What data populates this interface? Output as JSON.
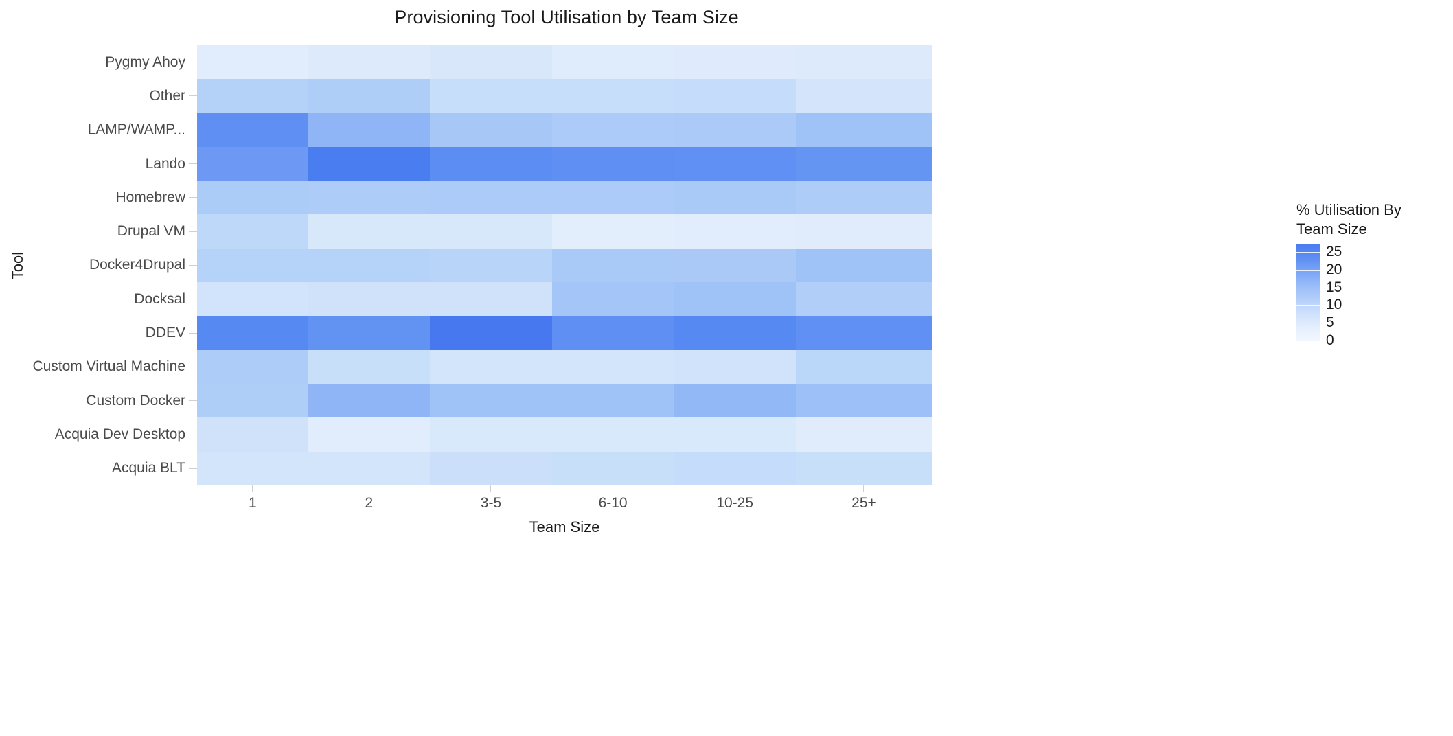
{
  "chart_data": {
    "type": "heatmap",
    "title": "Provisioning Tool Utilisation by Team Size",
    "xlabel": "Team Size",
    "ylabel": "Tool",
    "legend_title": "% Utilisation By\nTeam Size",
    "legend_position": "right",
    "grid": false,
    "x_categories": [
      "1",
      "2",
      "3-5",
      "6-10",
      "10-25",
      "25+"
    ],
    "y_categories": [
      "Pygmy Ahoy",
      "Other",
      "LAMP/WAMP...",
      "Lando",
      "Homebrew",
      "Drupal VM",
      "Docker4Drupal",
      "Docksal",
      "DDEV",
      "Custom Virtual Machine",
      "Custom Docker",
      "Acquia Dev Desktop",
      "Acquia BLT"
    ],
    "zlim": [
      0,
      27
    ],
    "legend_ticks": [
      "25",
      "20",
      "15",
      "10",
      "5",
      "0"
    ],
    "legend_tick_values": [
      25,
      20,
      15,
      10,
      5,
      0
    ],
    "colorscale_low": "#f2f7ff",
    "colorscale_high": "#3f6fe8",
    "values": [
      [
        3.0,
        3.2,
        4.0,
        3.4,
        3.0,
        3.2
      ],
      [
        9.0,
        10.5,
        6.5,
        6.5,
        6.8,
        4.5
      ],
      [
        23.0,
        14.5,
        11.0,
        10.0,
        10.5,
        12.5
      ],
      [
        20.5,
        26.5,
        22.0,
        21.5,
        21.0,
        20.0
      ],
      [
        9.5,
        9.5,
        9.5,
        9.5,
        10.0,
        9.5
      ],
      [
        7.5,
        4.5,
        4.5,
        3.0,
        3.5,
        3.5
      ],
      [
        8.5,
        8.5,
        8.0,
        10.0,
        10.0,
        11.5
      ],
      [
        5.0,
        5.5,
        5.5,
        11.0,
        11.5,
        9.0
      ],
      [
        21.5,
        19.5,
        25.0,
        20.0,
        21.5,
        20.0
      ],
      [
        9.5,
        6.5,
        5.0,
        5.0,
        5.5,
        8.0
      ],
      [
        9.5,
        14.5,
        11.5,
        11.5,
        14.0,
        12.0
      ],
      [
        5.5,
        3.5,
        4.5,
        4.5,
        4.5,
        3.5
      ],
      [
        5.0,
        5.0,
        6.0,
        6.5,
        7.0,
        6.5
      ]
    ],
    "cell_colors": [
      [
        "#e1edfc",
        "#ddeafb",
        "#d9e7fb",
        "#dfecfc",
        "#dfebfc",
        "#ddeafb"
      ],
      [
        "#b4d2f8",
        "#aecdf7",
        "#c7defa",
        "#c7defa",
        "#c5ddfa",
        "#d4e5fb"
      ],
      [
        "#5f8ff3",
        "#8fb5f6",
        "#a7c8f7",
        "#accbf8",
        "#abcaf8",
        "#9fc2f7"
      ],
      [
        "#6d99f4",
        "#4a7df0",
        "#5c8df2",
        "#5f8ff3",
        "#6090f3",
        "#6495f3"
      ],
      [
        "#acccf8",
        "#adccf8",
        "#accbf8",
        "#accbf8",
        "#a9c9f7",
        "#adccf8"
      ],
      [
        "#bdd8f9",
        "#d7e8fb",
        "#d7e8fb",
        "#e3eefc",
        "#e1edfc",
        "#e0ecfc"
      ],
      [
        "#b5d3f8",
        "#b5d3f8",
        "#b8d4f9",
        "#a9c9f7",
        "#aac9f7",
        "#9fc3f7"
      ],
      [
        "#d2e4fb",
        "#cfe2fa",
        "#cfe2fa",
        "#a3c5f7",
        "#a0c3f7",
        "#b1cef8"
      ],
      [
        "#5689f1",
        "#6293f3",
        "#4878ef",
        "#5f8ff3",
        "#5689f1",
        "#6090f3"
      ],
      [
        "#adccf8",
        "#c8dffa",
        "#d3e5fb",
        "#d3e5fb",
        "#d0e3fb",
        "#bad6f9"
      ],
      [
        "#aecdf7",
        "#8fb5f6",
        "#9fc3f7",
        "#9fc3f7",
        "#93b8f6",
        "#9cc0f7"
      ],
      [
        "#cfe2fa",
        "#e1edfc",
        "#d8e9fb",
        "#d8e9fb",
        "#d8e9fb",
        "#e0ecfc"
      ],
      [
        "#d3e5fb",
        "#d3e5fb",
        "#ccdffa",
        "#c8dffa",
        "#c5ddfa",
        "#c8dffa"
      ]
    ]
  }
}
